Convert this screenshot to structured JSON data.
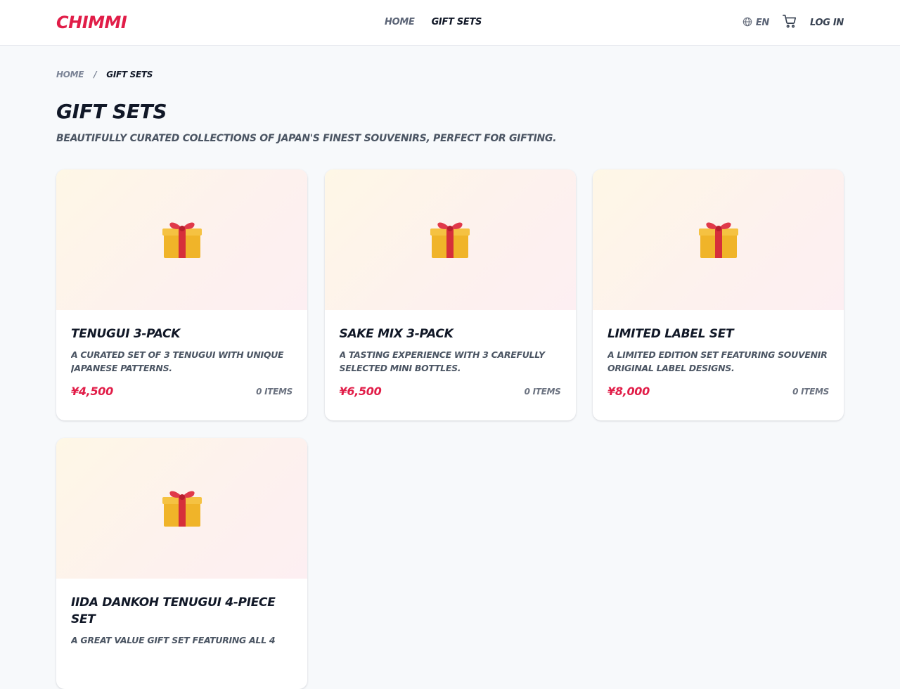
{
  "header": {
    "logo": "CHIMMI",
    "nav": [
      {
        "label": "HOME",
        "active": false
      },
      {
        "label": "GIFT SETS",
        "active": true
      }
    ],
    "language": "EN",
    "login_label": "LOG IN"
  },
  "breadcrumb": {
    "home": "HOME",
    "separator": "/",
    "current": "GIFT SETS"
  },
  "page": {
    "title": "GIFT SETS",
    "subtitle": "BEAUTIFULLY CURATED COLLECTIONS OF JAPAN'S FINEST SOUVENIRS, PERFECT FOR GIFTING."
  },
  "products": [
    {
      "title": "TENUGUI 3-PACK",
      "description": "A CURATED SET OF 3 TENUGUI WITH UNIQUE JAPANESE PATTERNS.",
      "price": "¥4,500",
      "items": "0 ITEMS",
      "icon": "🎁"
    },
    {
      "title": "SAKE MIX 3-PACK",
      "description": "A TASTING EXPERIENCE WITH 3 CAREFULLY SELECTED MINI BOTTLES.",
      "price": "¥6,500",
      "items": "0 ITEMS",
      "icon": "🎁"
    },
    {
      "title": "LIMITED LABEL SET",
      "description": "A LIMITED EDITION SET FEATURING SOUVENIR ORIGINAL LABEL DESIGNS.",
      "price": "¥8,000",
      "items": "0 ITEMS",
      "icon": "🎁"
    },
    {
      "title": "IIDA DANKOH TENUGUI 4-PIECE SET",
      "description": "A GREAT VALUE GIFT SET FEATURING ALL 4",
      "price": "",
      "items": "",
      "icon": "🎁"
    }
  ],
  "colors": {
    "brand": "#e11d48",
    "text": "#111827",
    "muted": "#4b5563",
    "background": "#f7f9fb"
  }
}
